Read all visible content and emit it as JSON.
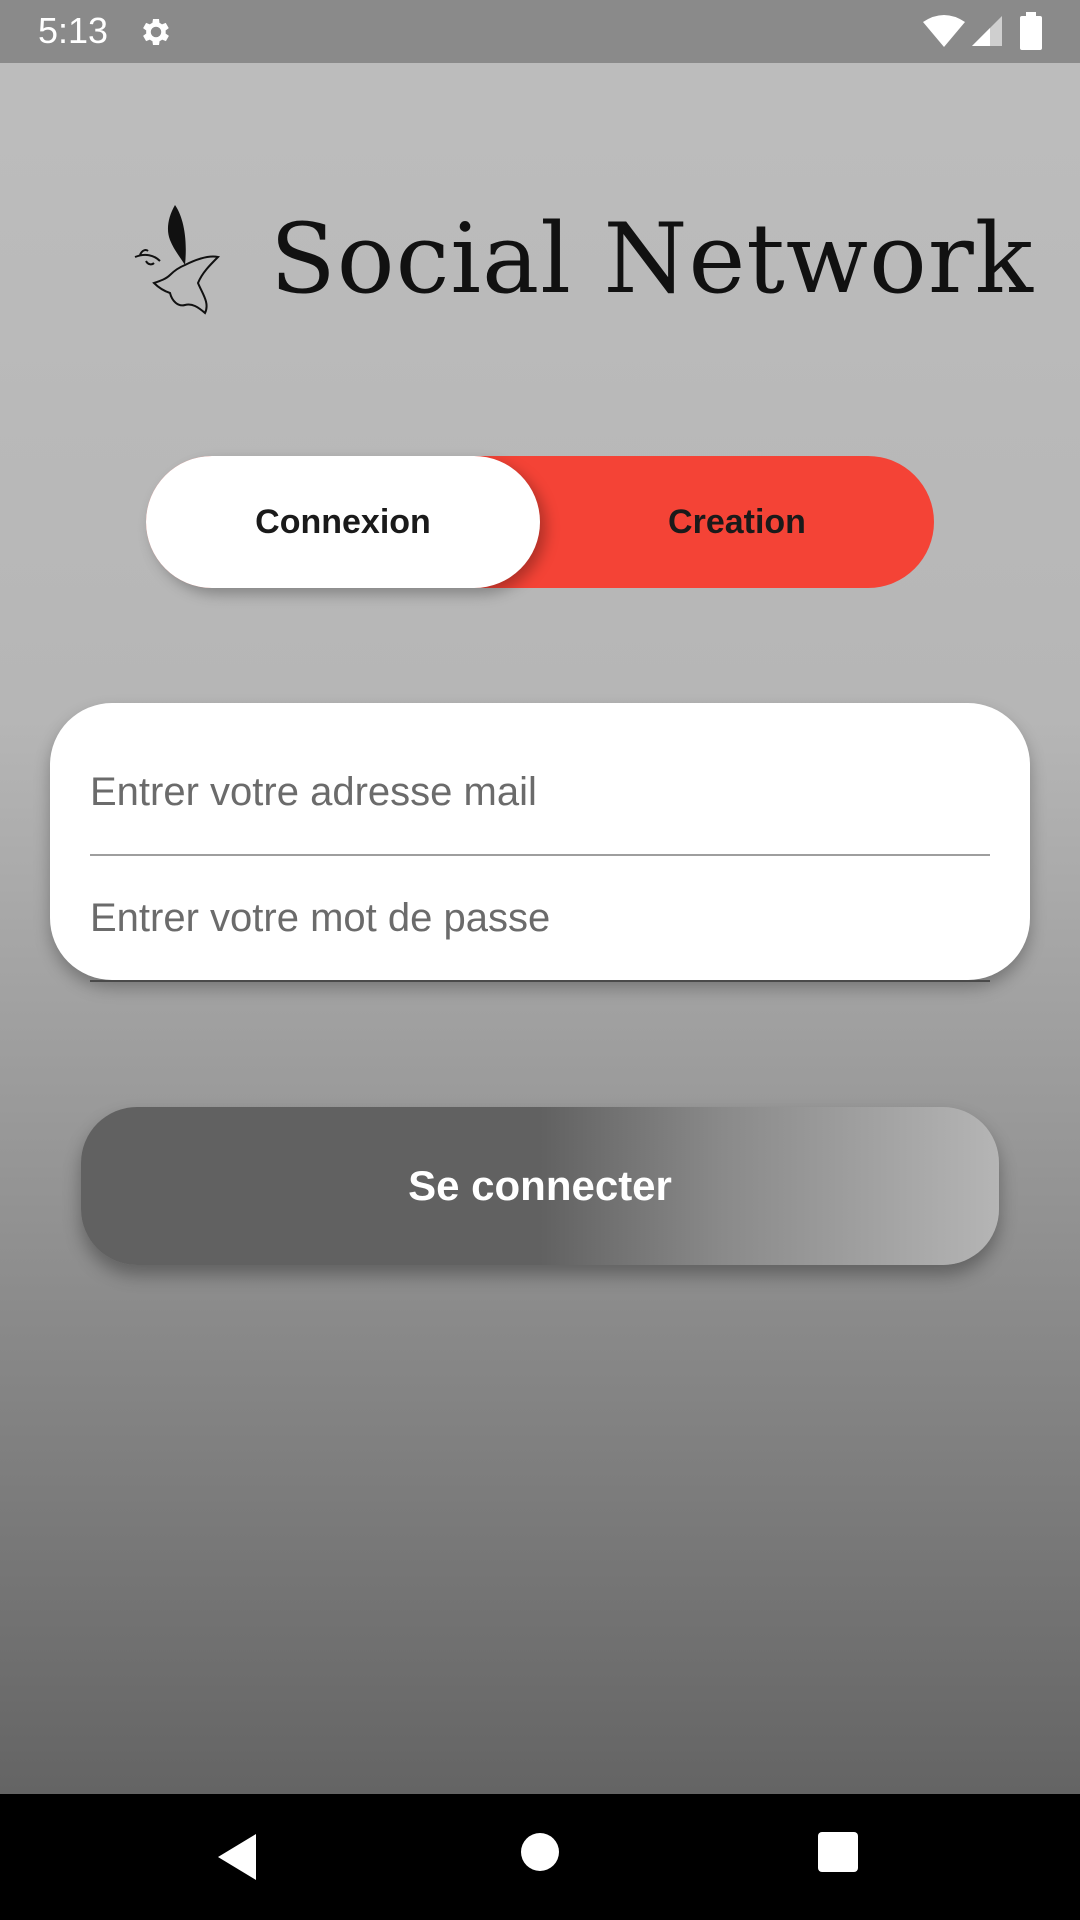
{
  "status_bar": {
    "time": "5:13",
    "icons": [
      "gear-icon",
      "wifi-icon",
      "signal-icon",
      "battery-icon"
    ]
  },
  "logo": {
    "text": "Social Network",
    "icon": "dove-icon"
  },
  "auth_toggle": {
    "options": [
      {
        "label": "Connexion",
        "selected": true
      },
      {
        "label": "Creation",
        "selected": false
      }
    ],
    "accent_color": "#f44336"
  },
  "form": {
    "email": {
      "placeholder": "Entrer votre adresse mail",
      "value": ""
    },
    "password": {
      "placeholder": "Entrer votre mot de passe",
      "value": ""
    }
  },
  "login_button": {
    "label": "Se connecter"
  },
  "nav_bar": {
    "icons": [
      "back-icon",
      "home-icon",
      "recents-icon"
    ]
  }
}
